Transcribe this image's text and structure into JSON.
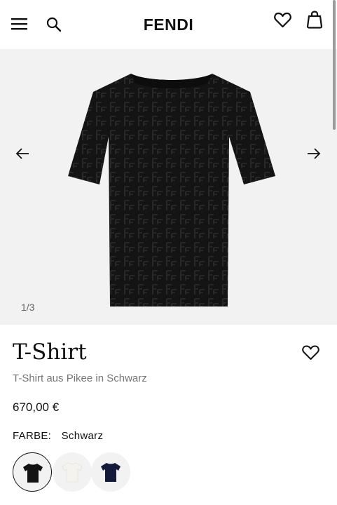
{
  "header": {
    "logo": "FENDI",
    "menu_icon": "hamburger-menu-icon",
    "search_icon": "search-icon",
    "wishlist_icon": "heart-icon",
    "bag_icon": "shopping-bag-icon"
  },
  "gallery": {
    "counter": "1/3",
    "prev_icon": "arrow-left-icon",
    "next_icon": "arrow-right-icon"
  },
  "product": {
    "title": "T-Shirt",
    "subtitle": "T-Shirt aus Pikee in Schwarz",
    "price": "670,00 €",
    "color_label": "FARBE:",
    "color_value": "Schwarz",
    "favorite_icon": "heart-icon"
  },
  "swatches": [
    {
      "name": "Schwarz",
      "color": "#121212",
      "selected": true
    },
    {
      "name": "Weiß",
      "color": "#f4f3ee",
      "selected": false
    },
    {
      "name": "Navy",
      "color": "#141b3a",
      "selected": false
    }
  ],
  "colors": {
    "hero_background": "#f2f2f2",
    "text": "#111111",
    "muted_text": "#757575"
  }
}
